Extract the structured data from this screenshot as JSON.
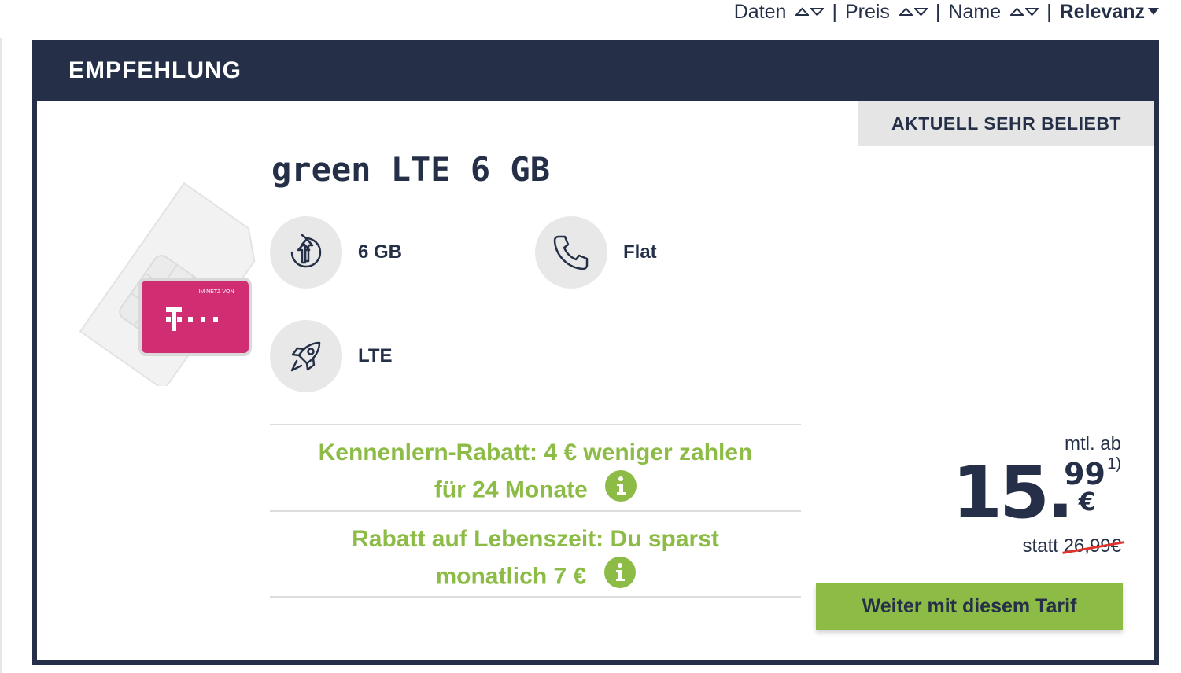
{
  "sort": {
    "items": [
      {
        "label": "Daten"
      },
      {
        "label": "Preis"
      },
      {
        "label": "Name"
      }
    ],
    "active_label": "Relevanz",
    "separator": "|"
  },
  "card": {
    "header": "EMPFEHLUNG",
    "badge": "AKTUELL SEHR BELIEBT",
    "title": "green LTE 6 GB",
    "sim_network_label": "IM NETZ VON",
    "features": [
      {
        "icon": "data-transfer-icon",
        "label": "6 GB"
      },
      {
        "icon": "phone-icon",
        "label": "Flat"
      },
      {
        "icon": "rocket-icon",
        "label": "LTE"
      }
    ],
    "promos": [
      {
        "line1": "Kennenlern-Rabatt: 4 € weniger zahlen",
        "line2": "für 24 Monate"
      },
      {
        "line1": "Rabatt auf Lebenszeit: Du sparst",
        "line2": "monatlich 7 €"
      }
    ],
    "price": {
      "prefix": "mtl. ab",
      "euros": "15.",
      "cents": "99",
      "currency": "€",
      "footnote": "1)",
      "statt_label": "statt",
      "old_price_main": "26",
      "old_price_rest": ",99€"
    },
    "cta_label": "Weiter mit diesem Tarif"
  },
  "colors": {
    "navy": "#253048",
    "green": "#8cbb46",
    "magenta": "#d02d72",
    "strike_red": "#e0342b"
  }
}
